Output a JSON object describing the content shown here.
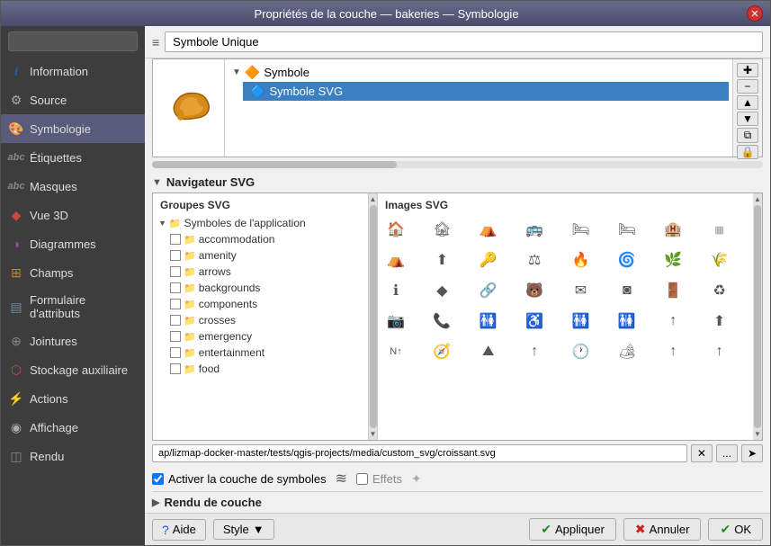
{
  "window": {
    "title": "Propriétés de la couche — bakeries — Symbologie",
    "close_icon": "✕"
  },
  "search": {
    "placeholder": ""
  },
  "sidebar": {
    "items": [
      {
        "id": "information",
        "label": "Information",
        "icon": "ℹ",
        "icon_color": "#2255cc"
      },
      {
        "id": "source",
        "label": "Source",
        "icon": "⚙",
        "icon_color": "#aaa"
      },
      {
        "id": "symbologie",
        "label": "Symbologie",
        "icon": "◈",
        "icon_color": "#cc8800",
        "active": true
      },
      {
        "id": "etiquettes",
        "label": "Étiquettes",
        "icon": "abc",
        "icon_color": "#aaa"
      },
      {
        "id": "masques",
        "label": "Masques",
        "icon": "abc",
        "icon_color": "#aaa"
      },
      {
        "id": "vue3d",
        "label": "Vue 3D",
        "icon": "◆",
        "icon_color": "#cc4444"
      },
      {
        "id": "diagrammes",
        "label": "Diagrammes",
        "icon": "◑",
        "icon_color": "#aa44aa"
      },
      {
        "id": "champs",
        "label": "Champs",
        "icon": "⊞",
        "icon_color": "#cc8800"
      },
      {
        "id": "formulaire",
        "label": "Formulaire d'attributs",
        "icon": "▤",
        "icon_color": "#6688cc"
      },
      {
        "id": "jointures",
        "label": "Jointures",
        "icon": "⊕",
        "icon_color": "#888"
      },
      {
        "id": "stockage",
        "label": "Stockage auxiliaire",
        "icon": "⬡",
        "icon_color": "#cc4444"
      },
      {
        "id": "actions",
        "label": "Actions",
        "icon": "⚡",
        "icon_color": "#888"
      },
      {
        "id": "affichage",
        "label": "Affichage",
        "icon": "◉",
        "icon_color": "#aaa"
      },
      {
        "id": "rendu",
        "label": "Rendu",
        "icon": "◫",
        "icon_color": "#888"
      }
    ]
  },
  "top_dropdown": {
    "label": "Symbole Unique",
    "icon": "≡"
  },
  "symbol_tree": {
    "rows": [
      {
        "level": 0,
        "arrow": "▼",
        "icon": "🔶",
        "label": "Symbole",
        "selected": false
      },
      {
        "level": 1,
        "arrow": "",
        "icon": "🔷",
        "label": "Symbole SVG",
        "selected": true
      }
    ]
  },
  "tree_buttons": [
    {
      "id": "add",
      "icon": "✚"
    },
    {
      "id": "remove",
      "icon": "−"
    },
    {
      "id": "up",
      "icon": "▲"
    },
    {
      "id": "down",
      "icon": "▼"
    },
    {
      "id": "copy",
      "icon": "⧉"
    },
    {
      "id": "lock",
      "icon": "🔒"
    }
  ],
  "svg_navigator": {
    "title": "Navigateur SVG",
    "groups_title": "Groupes SVG",
    "images_title": "Images SVG",
    "groups": [
      {
        "level": 1,
        "label": "Symboles de l'application",
        "has_arrow": true
      },
      {
        "level": 2,
        "label": "accommodation"
      },
      {
        "level": 2,
        "label": "amenity"
      },
      {
        "level": 2,
        "label": "arrows"
      },
      {
        "level": 2,
        "label": "backgrounds"
      },
      {
        "level": 2,
        "label": "components"
      },
      {
        "level": 2,
        "label": "crosses"
      },
      {
        "level": 2,
        "label": "emergency"
      },
      {
        "level": 2,
        "label": "entertainment"
      },
      {
        "level": 2,
        "label": "food"
      }
    ],
    "images": [
      "🏠",
      "🏚",
      "⛺",
      "🚌",
      "🛏",
      "🛏",
      "🏨",
      "🏘",
      "⛺",
      "⬆",
      "🔑",
      "⚖",
      "🔥",
      "🌀",
      "🌿",
      "🌾",
      "ℹ",
      "◆",
      "🔗",
      "🐻",
      "✉",
      "◙",
      "🚪",
      "♻",
      "📷",
      "📞",
      "🚻",
      "♿",
      "🚻",
      "🚻",
      "↑",
      "⬆",
      "⛰",
      "⛰",
      "⛰",
      "↑",
      "🕐",
      "🏕",
      "↑",
      "↑"
    ]
  },
  "path_bar": {
    "value": "ap/lizmap-docker-master/tests/qgis-projects/media/custom_svg/croissant.svg",
    "btn_clear": "✕",
    "btn_browse": "...",
    "btn_arrow": "➤"
  },
  "activate_bar": {
    "checkbox_activate": true,
    "label_activate": "Activer la couche de symboles",
    "icon_activate": "≋",
    "checkbox_effects": false,
    "label_effects": "Effets",
    "icon_effects": "✦"
  },
  "rendu": {
    "title": "Rendu de couche",
    "arrow": "▶"
  },
  "bottom_bar": {
    "help_label": "?Aide",
    "style_label": "Style",
    "style_arrow": "▼",
    "apply_label": "Appliquer",
    "cancel_label": "Annuler",
    "ok_label": "OK",
    "apply_icon": "✔",
    "cancel_icon": "✖",
    "ok_icon": "✔"
  }
}
